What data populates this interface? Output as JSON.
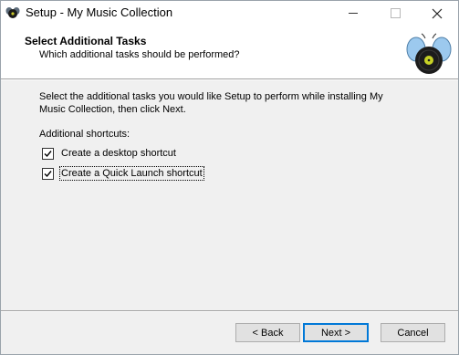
{
  "window": {
    "title": "Setup - My Music Collection"
  },
  "header": {
    "title": "Select Additional Tasks",
    "subtitle": "Which additional tasks should be performed?"
  },
  "content": {
    "description": "Select the additional tasks you would like Setup to perform while installing My Music Collection, then click Next.",
    "group_label": "Additional shortcuts:",
    "tasks": [
      {
        "label": "Create a desktop shortcut",
        "checked": true
      },
      {
        "label": "Create a Quick Launch shortcut",
        "checked": true
      }
    ]
  },
  "buttons": {
    "back": "< Back",
    "next": "Next >",
    "cancel": "Cancel"
  },
  "colors": {
    "accent": "#0078d7",
    "window_bg": "#f0f0f0",
    "header_bg": "#ffffff"
  }
}
